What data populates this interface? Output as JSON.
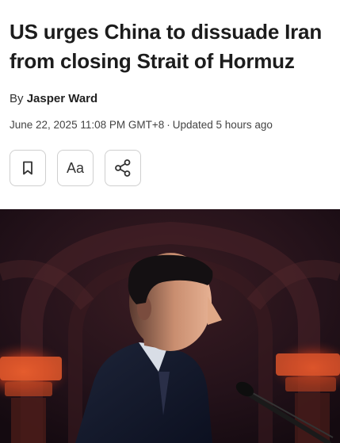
{
  "article": {
    "headline": "US urges China to dissuade Iran from closing Strait of Hormuz",
    "byline_prefix": "By",
    "author": "Jasper Ward",
    "published": "June 22, 2025 11:08 PM GMT+8",
    "separator": "·",
    "updated": "Updated 5 hours ago"
  },
  "actions": [
    {
      "name": "bookmark",
      "icon": "bookmark-icon"
    },
    {
      "name": "text-size",
      "label": "Aa"
    },
    {
      "name": "share",
      "icon": "share-icon"
    }
  ],
  "colors": {
    "text": "#1c1c1c",
    "button_border": "#cfcfcf",
    "hero_bg": "#2a1418",
    "hero_glow": "#e0552a"
  }
}
